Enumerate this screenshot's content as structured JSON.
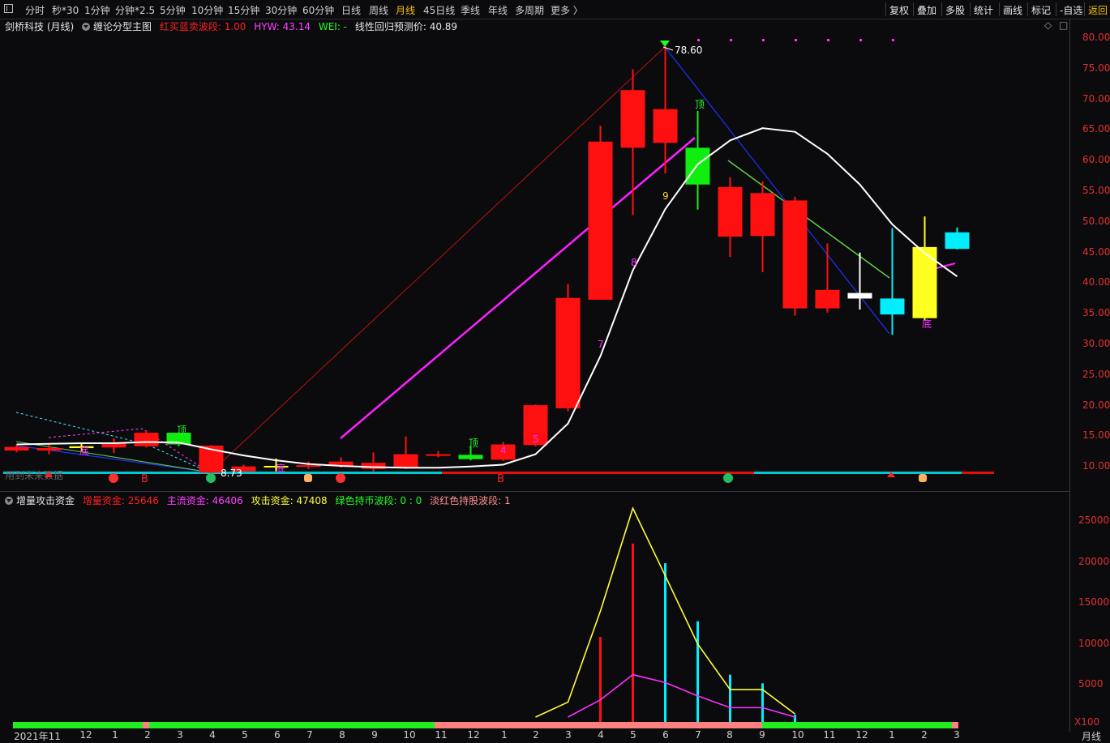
{
  "topbar": {
    "periods": [
      "分时",
      "秒*30",
      "1分钟",
      "分钟*2.5",
      "5分钟",
      "10分钟",
      "15分钟",
      "30分钟",
      "60分钟",
      "日线",
      "周线",
      "月线",
      "45日线",
      "季线",
      "年线",
      "多周期",
      "更多 〉"
    ],
    "active_period": "月线",
    "tools": [
      "复权",
      "叠加",
      "多股",
      "统计",
      "画线",
      "标记",
      "-自选",
      "返回"
    ],
    "active_tool": "返回"
  },
  "main_info": {
    "stock_name": "剑桥科技 (月线)",
    "indicator_name": "缠论分型主图",
    "wave_label": "红买蓝卖波段: 1.00",
    "hyw_label": "HYW: 43.14",
    "wei_label": "WEI: -",
    "regression_label": "线性回归预测价: 40.89",
    "icons": [
      "◇",
      "□"
    ]
  },
  "main_chart_annotations": {
    "high_value": "78.60",
    "low_value": "8.73",
    "left_faded_text": "用到未来数据",
    "ding": "顶",
    "di": "底",
    "b_marker": "B"
  },
  "sub_info": {
    "indicator_name": "增量攻击资金",
    "zengliang": "增量资金: 25646",
    "zhuliu": "主流资金: 46406",
    "gongji": "攻击资金: 47408",
    "green_wave": "绿色持币波段: 0 : 0",
    "pink_wave": "淡红色持股波段: 1"
  },
  "price_axis": [
    "80.00",
    "75.00",
    "70.00",
    "65.00",
    "60.00",
    "55.00",
    "50.00",
    "45.00",
    "40.00",
    "35.00",
    "30.00",
    "25.00",
    "20.00",
    "15.00",
    "10.00"
  ],
  "volume_axis": [
    "25000",
    "20000",
    "15000",
    "10000",
    "5000"
  ],
  "volume_unit": "X100",
  "period_footer": "月线",
  "time_axis": [
    "2021年11",
    "12",
    "1",
    "2",
    "3",
    "4",
    "5",
    "6",
    "7",
    "8",
    "9",
    "10",
    "11",
    "12",
    "1",
    "2",
    "3",
    "4",
    "5",
    "6",
    "7",
    "8",
    "9",
    "10",
    "11",
    "12",
    "1",
    "2",
    "3"
  ],
  "colors": {
    "up": "#ff1010",
    "down": "#00e5ff",
    "ma_white": "#ffffff",
    "magenta": "#ff20ff",
    "yellow": "#ffff30",
    "green": "#20ff20",
    "axis": "#e03030"
  },
  "chart_data": {
    "type": "candlestick",
    "ylim": [
      7,
      81
    ],
    "months": [
      "2021-11",
      "2021-12",
      "2022-01",
      "2022-02",
      "2022-03",
      "2022-04",
      "2022-05",
      "2022-06",
      "2022-07",
      "2022-08",
      "2022-09",
      "2022-10",
      "2022-11",
      "2022-12",
      "2023-01",
      "2023-02",
      "2023-03",
      "2023-04",
      "2023-05",
      "2023-06",
      "2023-07",
      "2023-08",
      "2023-09",
      "2023-10",
      "2023-11",
      "2023-12",
      "2024-01",
      "2024-02",
      "2024-03"
    ],
    "candles": [
      {
        "o": 12.6,
        "c": 13.2,
        "h": 13.6,
        "l": 12.3,
        "color": "red"
      },
      {
        "o": 12.6,
        "c": 13.0,
        "h": 13.8,
        "l": 12.0,
        "color": "red"
      },
      {
        "o": 13.0,
        "c": 13.3,
        "h": 13.9,
        "l": 12.5,
        "color": "yellow"
      },
      {
        "o": 13.1,
        "c": 13.8,
        "h": 14.6,
        "l": 12.2,
        "color": "red"
      },
      {
        "o": 13.3,
        "c": 15.5,
        "h": 15.9,
        "l": 13.1,
        "color": "red"
      },
      {
        "o": 13.6,
        "c": 15.5,
        "h": 15.6,
        "l": 13.3,
        "color": "green"
      },
      {
        "o": 9.0,
        "c": 13.4,
        "h": 13.5,
        "l": 8.73,
        "color": "red"
      },
      {
        "o": 9.2,
        "c": 10.0,
        "h": 10.3,
        "l": 9.1,
        "color": "red"
      },
      {
        "o": 10.0,
        "c": 10.1,
        "h": 11.3,
        "l": 9.2,
        "color": "yellow"
      },
      {
        "o": 10.0,
        "c": 10.2,
        "h": 10.8,
        "l": 9.6,
        "color": "red"
      },
      {
        "o": 10.1,
        "c": 10.8,
        "h": 11.5,
        "l": 9.8,
        "color": "red"
      },
      {
        "o": 9.6,
        "c": 10.6,
        "h": 12.3,
        "l": 9.2,
        "color": "red"
      },
      {
        "o": 9.8,
        "c": 12.0,
        "h": 14.9,
        "l": 9.6,
        "color": "red"
      },
      {
        "o": 11.9,
        "c": 12.0,
        "h": 12.5,
        "l": 11.5,
        "color": "red"
      },
      {
        "o": 11.2,
        "c": 11.9,
        "h": 13.3,
        "l": 11.0,
        "color": "green"
      },
      {
        "o": 11.1,
        "c": 13.6,
        "h": 14.0,
        "l": 10.9,
        "color": "red"
      },
      {
        "o": 13.5,
        "c": 20.0,
        "h": 20.1,
        "l": 13.3,
        "color": "red"
      },
      {
        "o": 19.5,
        "c": 37.5,
        "h": 39.8,
        "l": 19.0,
        "color": "red"
      },
      {
        "o": 37.2,
        "c": 63.0,
        "h": 65.6,
        "l": 37.2,
        "color": "red"
      },
      {
        "o": 62.0,
        "c": 71.4,
        "h": 74.8,
        "l": 51.0,
        "color": "red"
      },
      {
        "o": 62.8,
        "c": 68.3,
        "h": 78.6,
        "l": 57.8,
        "color": "red"
      },
      {
        "o": 62.0,
        "c": 56.0,
        "h": 68.0,
        "l": 51.9,
        "color": "green"
      },
      {
        "o": 47.5,
        "c": 55.6,
        "h": 57.2,
        "l": 44.2,
        "color": "red"
      },
      {
        "o": 47.6,
        "c": 54.6,
        "h": 56.5,
        "l": 41.7,
        "color": "red"
      },
      {
        "o": 35.8,
        "c": 53.4,
        "h": 54.0,
        "l": 34.6,
        "color": "red"
      },
      {
        "o": 35.8,
        "c": 38.8,
        "h": 46.4,
        "l": 35.1,
        "color": "red"
      },
      {
        "o": 38.3,
        "c": 37.4,
        "h": 44.9,
        "l": 35.6,
        "color": "white"
      },
      {
        "o": 37.4,
        "c": 34.8,
        "h": 48.9,
        "l": 31.5,
        "color": "cyan"
      },
      {
        "o": 34.2,
        "c": 45.8,
        "h": 50.8,
        "l": 33.8,
        "color": "yellow"
      },
      {
        "o": 45.5,
        "c": 48.2,
        "h": 49.0,
        "l": 45.4,
        "color": "cyan"
      }
    ],
    "ma_white": [
      13.6,
      13.7,
      13.8,
      13.8,
      14.0,
      13.9,
      12.8,
      11.8,
      11.0,
      10.4,
      10.1,
      9.9,
      9.8,
      9.8,
      10.0,
      10.3,
      12.0,
      17.0,
      28.0,
      42.0,
      52.0,
      59.3,
      63.2,
      65.2,
      64.6,
      61.0,
      56.0,
      49.5,
      44.8,
      41.0
    ],
    "volume": {
      "ylim": [
        0,
        27500
      ],
      "yellow_line": [
        null,
        null,
        null,
        null,
        null,
        null,
        null,
        null,
        null,
        null,
        null,
        null,
        null,
        null,
        null,
        null,
        0,
        1900,
        13500,
        26600,
        18000,
        9300,
        3500,
        3500,
        400
      ],
      "magenta_line": [
        null,
        null,
        null,
        null,
        null,
        null,
        null,
        null,
        null,
        null,
        null,
        null,
        null,
        null,
        null,
        null,
        null,
        0,
        2200,
        5400,
        4400,
        2700,
        1200,
        1200,
        0
      ],
      "red_bars": [
        [
          18,
          10200
        ],
        [
          19,
          22100
        ]
      ],
      "cyan_bars": [
        [
          20,
          19600
        ],
        [
          21,
          12200
        ],
        [
          22,
          5400
        ],
        [
          23,
          4300
        ],
        [
          24,
          300
        ]
      ]
    }
  }
}
